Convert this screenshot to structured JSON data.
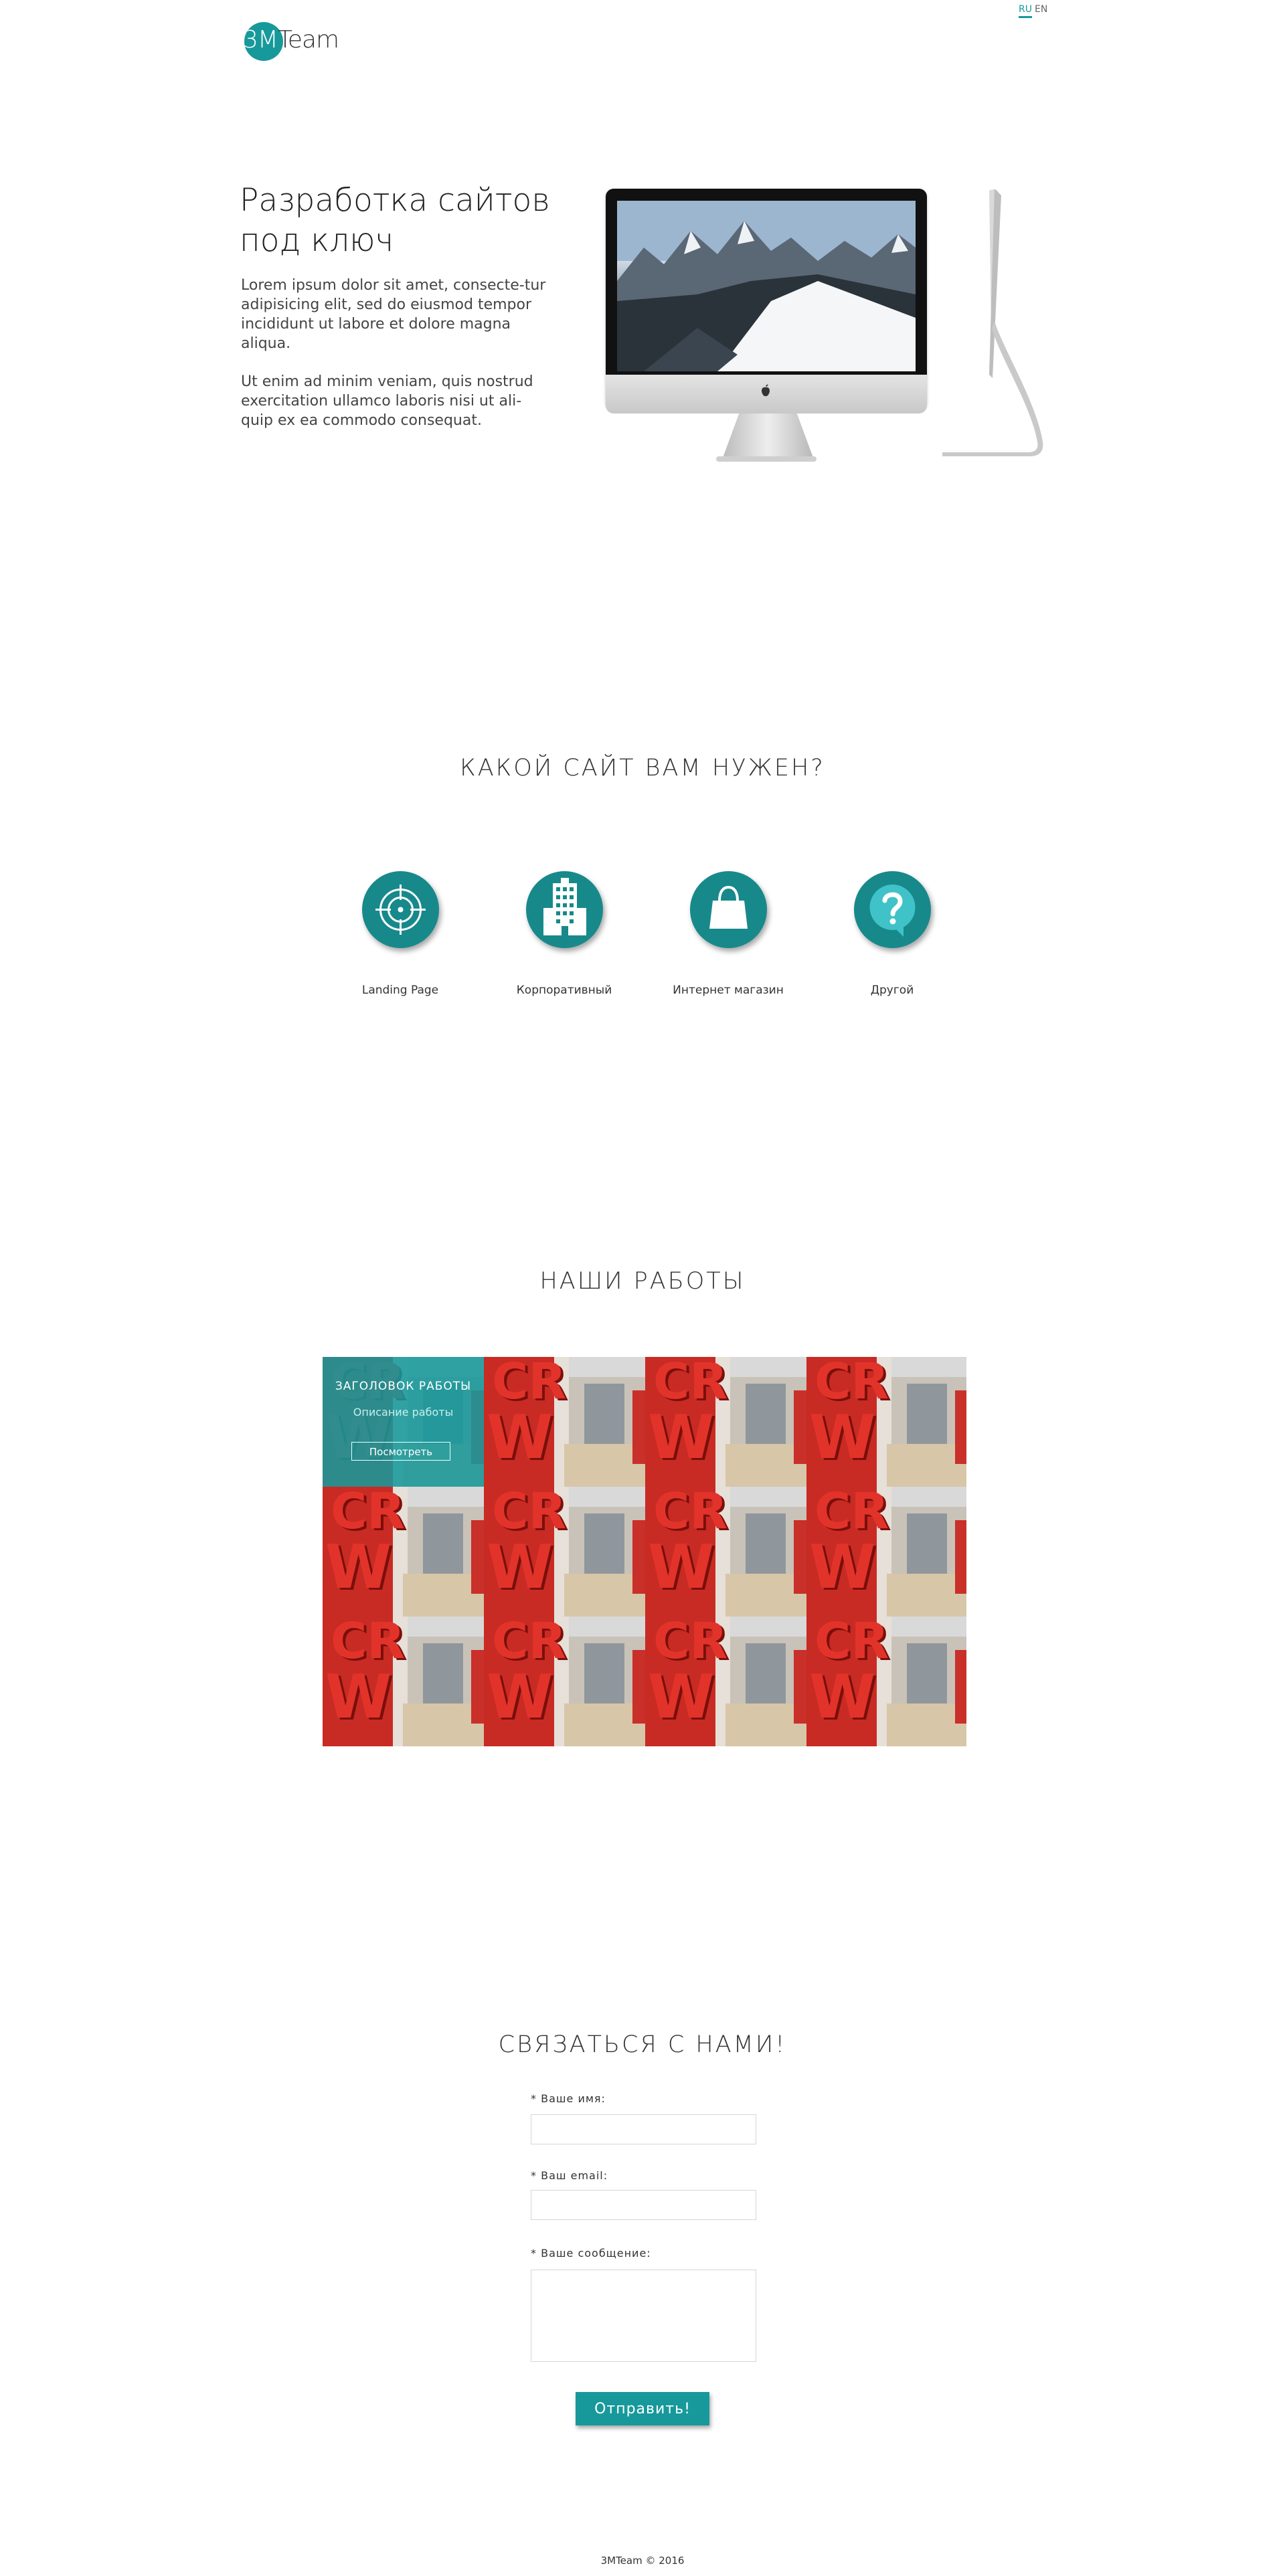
{
  "header": {
    "logo_prefix": "3M",
    "logo_suffix": "Team",
    "lang_ru": "RU",
    "lang_en": "EN"
  },
  "hero": {
    "title": "Разработка сайтов под ключ",
    "paragraph1": "Lorem ipsum dolor sit amet, consecte-tur adipisicing elit, sed do eiusmod tempor incididunt ut labore et dolore magna aliqua.",
    "paragraph2": "Ut enim ad minim veniam, quis nostrud exercitation ullamco laboris nisi ut ali-quip ex ea commodo consequat."
  },
  "services": {
    "title": "КАКОЙ САЙТ ВАМ НУЖЕН?",
    "items": [
      {
        "label": "Landing Page",
        "icon": "target-icon"
      },
      {
        "label": "Корпоративный",
        "icon": "building-icon"
      },
      {
        "label": "Интернет магазин",
        "icon": "shopping-bag-icon"
      },
      {
        "label": "Другой",
        "icon": "question-icon"
      }
    ]
  },
  "works": {
    "title": "НАШИ РАБОТЫ",
    "featured": {
      "title": "ЗАГОЛОВОК РАБОТЫ",
      "description": "Описание работы",
      "button": "Посмотреть"
    },
    "tile_letters_top": "CR",
    "tile_letters_bottom": "W"
  },
  "contact": {
    "title": "СВЯЗАТЬСЯ С НАМИ!",
    "name_label": "* Ваше имя:",
    "email_label": "* Ваш email:",
    "message_label": "* Ваше сообщение:",
    "submit": "Отправить!"
  },
  "footer": {
    "text": "3MTeam © 2016"
  },
  "colors": {
    "accent": "#17999b",
    "icon_circle": "#17898b"
  }
}
